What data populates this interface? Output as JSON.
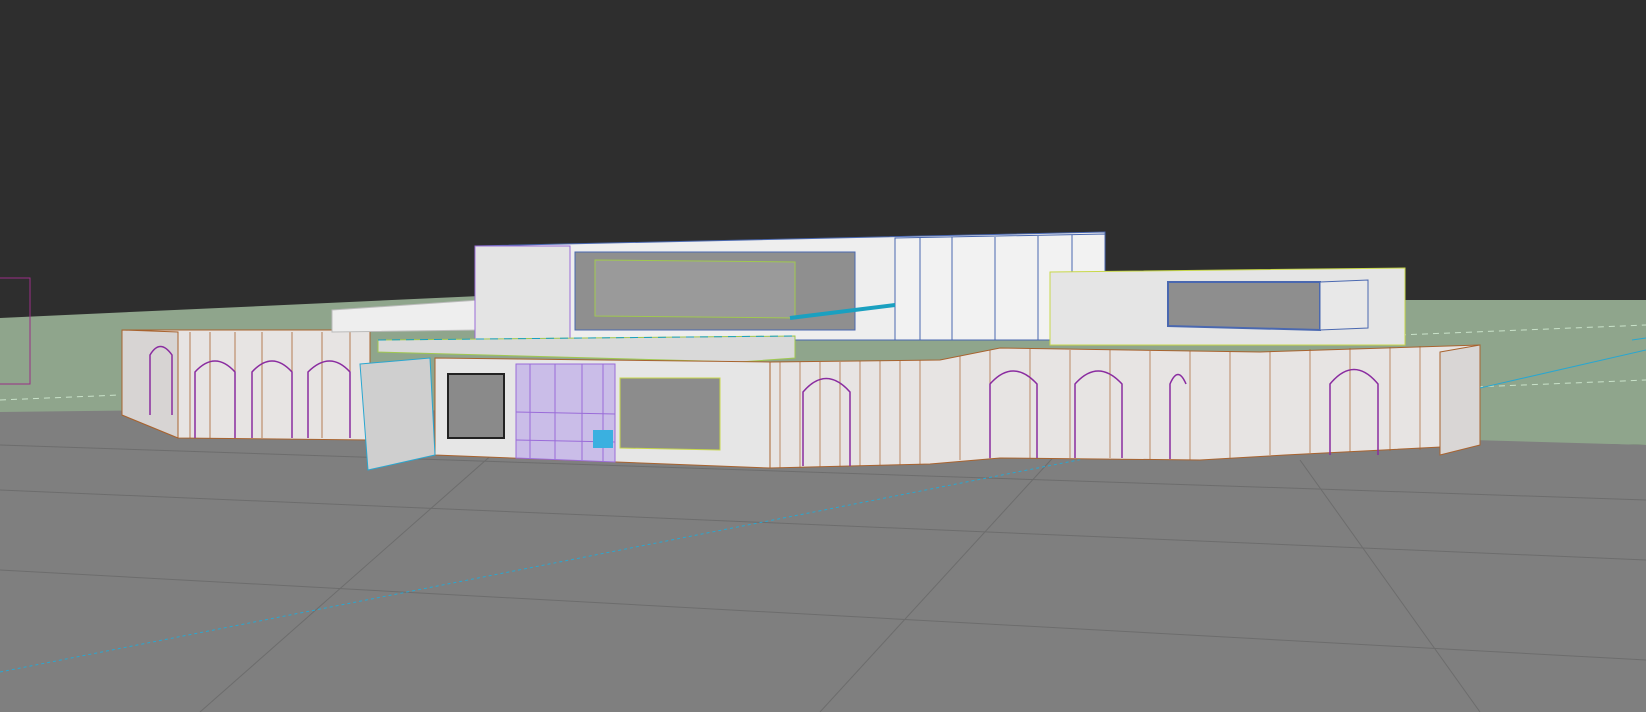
{
  "viewport": {
    "kind": "3d-perspective-viewport",
    "background_color": "#2e2e2e",
    "ground_color": "#7f7f7f",
    "terrain_color": "#8fa58c",
    "selection_colors": {
      "facade_wireframe": "#a8632f",
      "arches": "#8a2ca0",
      "upper_block": "#4a68b0",
      "glazing": "#b89ae8",
      "highlight": "#1aa0c0",
      "accent": "#a0c850"
    }
  },
  "scene_objects": [
    "ground-plane",
    "terrain-slope",
    "arcade-wall-left",
    "arcade-wall-right",
    "entrance-block",
    "glazed-entrance",
    "open-door-panel",
    "upper-volume",
    "right-upper-volume",
    "canopy-slab"
  ]
}
